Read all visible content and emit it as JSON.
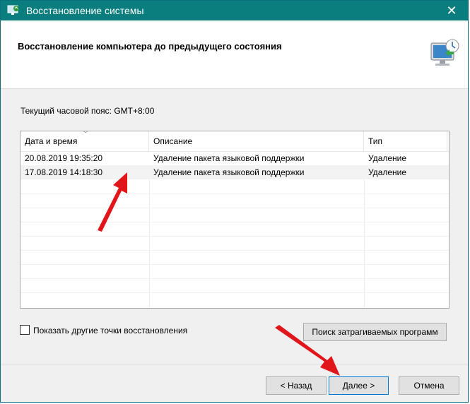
{
  "window": {
    "title": "Восстановление системы",
    "close_glyph": "✕"
  },
  "header": {
    "heading": "Восстановление компьютера до предыдущего состояния"
  },
  "timezone_label": "Текущий часовой пояс: GMT+8:00",
  "table": {
    "columns": [
      "Дата и время",
      "Описание",
      "Тип"
    ],
    "sorted_column": "Дата и время",
    "rows": [
      {
        "date": "20.08.2019 19:35:20",
        "description": "Удаление пакета языковой поддержки",
        "type": "Удаление"
      },
      {
        "date": "17.08.2019 14:18:30",
        "description": "Удаление пакета языковой поддержки",
        "type": "Удаление"
      }
    ]
  },
  "show_more": {
    "label": "Показать другие точки восстановления",
    "checked": false
  },
  "buttons": {
    "search": "Поиск затрагиваемых программ",
    "back": "< Назад",
    "next": "Далее >",
    "cancel": "Отмена"
  },
  "colors": {
    "titlebar": "#0a7d7f",
    "annotation_arrow": "#e0161b"
  },
  "icons": {
    "title_icon": "system-restore-icon",
    "header_icon": "monitor-restore-icon"
  }
}
